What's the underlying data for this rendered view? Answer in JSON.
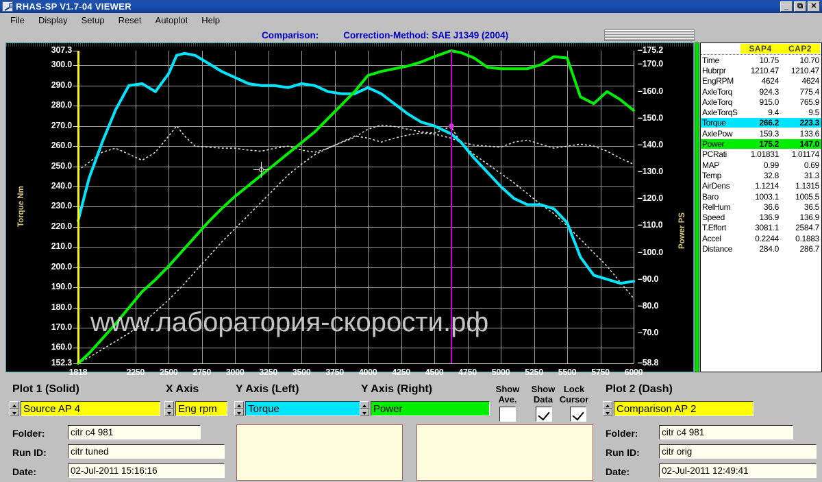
{
  "window": {
    "title": "RHAS-SP V1.7-04  VIEWER",
    "icon": "app-icon",
    "buttons": {
      "minimize": "_",
      "maximize": "❐",
      "close": "×"
    }
  },
  "menu": {
    "items": [
      "File",
      "Display",
      "Setup",
      "Reset",
      "Autoplot",
      "Help"
    ]
  },
  "header": {
    "comparison_label": "Comparison:",
    "correction_method": "Correction-Method: SAE J1349 (2004)"
  },
  "chart_data": {
    "type": "line",
    "title": "",
    "xlabel": "Eng rpm",
    "ylabel_left": "Torque Nm",
    "ylabel_right": "Power PS",
    "xlim": [
      1818,
      6000
    ],
    "ylim_left": [
      152.3,
      307.3
    ],
    "ylim_right": [
      58.8,
      175.2
    ],
    "grid": true,
    "x_ticks": [
      1818,
      2250,
      2500,
      2750,
      3000,
      3250,
      3500,
      3750,
      4000,
      4250,
      4500,
      4750,
      5000,
      5250,
      5500,
      5750,
      6000
    ],
    "y_ticks_left": [
      307.3,
      300.0,
      290.0,
      280.0,
      270.0,
      260.0,
      250.0,
      240.0,
      230.0,
      220.0,
      210.0,
      200.0,
      190.0,
      180.0,
      170.0,
      160.0,
      152.3
    ],
    "y_ticks_right": [
      175.2,
      170.0,
      160.0,
      150.0,
      140.0,
      130.0,
      120.0,
      110.0,
      100.0,
      90.0,
      80.0,
      70.0,
      58.8
    ],
    "cursor_left_rpm": 1818,
    "cursor_right_rpm": 4624,
    "watermark": "www.лаборатория-скорости.рф",
    "series": [
      {
        "name": "Torque AP4 (solid cyan)",
        "color": "#00E5FF",
        "style": "solid",
        "axis": "left",
        "x": [
          1818,
          1900,
          2000,
          2100,
          2200,
          2300,
          2400,
          2500,
          2560,
          2620,
          2700,
          2800,
          2900,
          3000,
          3100,
          3200,
          3300,
          3400,
          3500,
          3600,
          3700,
          3800,
          3900,
          4000,
          4100,
          4200,
          4300,
          4400,
          4500,
          4624,
          4700,
          4800,
          4900,
          5000,
          5100,
          5200,
          5300,
          5400,
          5500,
          5600,
          5700,
          5800,
          5900,
          6000
        ],
        "y": [
          223.0,
          244.0,
          262.0,
          278.0,
          290.0,
          291.0,
          287.0,
          296.0,
          305.0,
          306.0,
          305.0,
          301.0,
          297.0,
          294.0,
          291.0,
          290.0,
          290.0,
          289.0,
          291.0,
          290.0,
          287.0,
          286.0,
          286.0,
          289.0,
          286.0,
          281.0,
          276.0,
          272.0,
          270.0,
          266.2,
          262.0,
          254.0,
          247.0,
          240.0,
          234.0,
          231.0,
          231.0,
          229.0,
          222.0,
          205.0,
          196.0,
          194.0,
          192.0,
          193.0
        ]
      },
      {
        "name": "Power AP4 (solid green)",
        "color": "#00EE00",
        "style": "solid",
        "axis": "right",
        "x": [
          1818,
          1900,
          2000,
          2100,
          2200,
          2300,
          2400,
          2500,
          2600,
          2700,
          2800,
          2900,
          3000,
          3100,
          3200,
          3300,
          3400,
          3500,
          3600,
          3700,
          3800,
          3900,
          4000,
          4100,
          4200,
          4300,
          4400,
          4500,
          4624,
          4700,
          4800,
          4900,
          5000,
          5100,
          5200,
          5300,
          5400,
          5500,
          5600,
          5700,
          5800,
          5900,
          6000
        ],
        "y": [
          58.8,
          62.5,
          68.0,
          73.5,
          79.5,
          85.5,
          90.0,
          95.0,
          100.5,
          106.0,
          111.5,
          116.5,
          121.0,
          125.0,
          129.0,
          133.0,
          137.0,
          141.0,
          145.0,
          150.0,
          155.0,
          160.0,
          166.0,
          167.5,
          168.5,
          169.5,
          171.0,
          173.0,
          175.2,
          174.5,
          172.5,
          169.0,
          168.5,
          168.5,
          168.5,
          170.0,
          173.0,
          172.5,
          158.0,
          155.5,
          160.0,
          157.0,
          153.0
        ]
      },
      {
        "name": "Torque AP2 (dashed)",
        "color": "#D8D8D8",
        "style": "dashed",
        "axis": "left",
        "x": [
          1818,
          1900,
          2000,
          2100,
          2200,
          2300,
          2400,
          2500,
          2560,
          2620,
          2700,
          2800,
          2900,
          3000,
          3100,
          3200,
          3300,
          3400,
          3500,
          3600,
          3700,
          3800,
          3900,
          4000,
          4100,
          4200,
          4300,
          4400,
          4500,
          4624,
          4700,
          4800,
          4900,
          5000,
          5100,
          5200,
          5300,
          5400,
          5500,
          5600,
          5700,
          5800,
          5900,
          6000
        ],
        "y": [
          248.0,
          252.0,
          257.0,
          259.0,
          256.0,
          253.0,
          257.0,
          265.0,
          270.0,
          265.0,
          260.0,
          259.5,
          259.0,
          259.0,
          258.0,
          257.5,
          259.0,
          260.0,
          258.0,
          257.0,
          259.0,
          262.0,
          265.0,
          264.0,
          262.0,
          264.0,
          265.5,
          266.5,
          266.0,
          264.0,
          262.0,
          260.5,
          260.0,
          259.5,
          262.0,
          263.0,
          261.0,
          259.0,
          260.0,
          261.0,
          260.0,
          257.5,
          254.0,
          251.0
        ]
      },
      {
        "name": "Power AP2 (dashed)",
        "color": "#D8D8D8",
        "style": "dashed",
        "axis": "right",
        "x": [
          1818,
          1900,
          2000,
          2100,
          2200,
          2300,
          2400,
          2500,
          2600,
          2700,
          2800,
          2900,
          3000,
          3100,
          3200,
          3300,
          3400,
          3500,
          3600,
          3700,
          3800,
          3900,
          4000,
          4100,
          4200,
          4300,
          4400,
          4500,
          4624,
          4700,
          4800,
          4900,
          5000,
          5100,
          5200,
          5300,
          5400,
          5500,
          5600,
          5700,
          5800,
          5900,
          6000
        ],
        "y": [
          58.8,
          61.0,
          64.0,
          67.0,
          70.0,
          73.5,
          78.0,
          82.5,
          87.5,
          93.0,
          98.5,
          104.0,
          109.0,
          114.0,
          119.0,
          124.0,
          129.0,
          133.0,
          136.5,
          139.0,
          141.0,
          143.0,
          146.0,
          147.5,
          147.0,
          146.0,
          145.0,
          144.5,
          147.0,
          141.0,
          136.5,
          133.0,
          129.5,
          126.0,
          122.0,
          118.0,
          114.5,
          110.0,
          105.0,
          100.0,
          95.0,
          89.0,
          83.0
        ]
      }
    ]
  },
  "data_panel": {
    "columns": [
      "",
      "SAP4",
      "CAP2"
    ],
    "rows": [
      {
        "label": "Time",
        "v1": "10.75",
        "v2": "10.70",
        "highlight": "none"
      },
      {
        "label": "Hubrpr",
        "v1": "1210.47",
        "v2": "1210.47",
        "highlight": "none"
      },
      {
        "label": "EngRPM",
        "v1": "4624",
        "v2": "4624",
        "highlight": "none"
      },
      {
        "label": "AxleTorq",
        "v1": "924.3",
        "v2": "775.4",
        "highlight": "none"
      },
      {
        "label": "AxleTorq",
        "v1": "915.0",
        "v2": "765.9",
        "highlight": "none"
      },
      {
        "label": "AxleTorqS",
        "v1": "9.4",
        "v2": "9.5",
        "highlight": "none"
      },
      {
        "label": "Torque",
        "v1": "266.2",
        "v2": "223.3",
        "highlight": "torque"
      },
      {
        "label": "AxlePow",
        "v1": "159.3",
        "v2": "133.6",
        "highlight": "none"
      },
      {
        "label": "Power",
        "v1": "175.2",
        "v2": "147.0",
        "highlight": "power"
      },
      {
        "label": "PCRati",
        "v1": "1.01831",
        "v2": "1.01174",
        "highlight": "none"
      },
      {
        "label": "MAP",
        "v1": "0.99",
        "v2": "0.69",
        "highlight": "none"
      },
      {
        "label": "Temp",
        "v1": "32.8",
        "v2": "31.3",
        "highlight": "none"
      },
      {
        "label": "AirDens",
        "v1": "1.1214",
        "v2": "1.1315",
        "highlight": "none"
      },
      {
        "label": "Baro",
        "v1": "1003.1",
        "v2": "1005.5",
        "highlight": "none"
      },
      {
        "label": "RelHum",
        "v1": "36.6",
        "v2": "36.5",
        "highlight": "none"
      },
      {
        "label": "Speed",
        "v1": "136.9",
        "v2": "136.9",
        "highlight": "none"
      },
      {
        "label": "T.Effort",
        "v1": "3081.1",
        "v2": "2584.7",
        "highlight": "none"
      },
      {
        "label": "Accel",
        "v1": "0.2244",
        "v2": "0.1883",
        "highlight": "none"
      },
      {
        "label": "Distance",
        "v1": "284.0",
        "v2": "286.7",
        "highlight": "none"
      }
    ]
  },
  "controls": {
    "plot1": {
      "title": "Plot 1 (Solid)",
      "source_value": "Source AP 4",
      "folder_label": "Folder:",
      "folder_value": "citr c4 981",
      "runid_label": "Run ID:",
      "runid_value": "citr tuned",
      "date_label": "Date:",
      "date_value": "02-Jul-2011  15:16:16"
    },
    "x_axis": {
      "title": "X Axis",
      "value": "Eng rpm"
    },
    "y_axis_left": {
      "title": "Y Axis (Left)",
      "value": "Torque"
    },
    "y_axis_right": {
      "title": "Y Axis (Right)",
      "value": "Power"
    },
    "show_ave": {
      "line1": "Show",
      "line2": "Ave.",
      "checked": false
    },
    "show_data": {
      "line1": "Show",
      "line2": "Data",
      "checked": true
    },
    "lock_cursor": {
      "line1": "Lock",
      "line2": "Cursor",
      "checked": true
    },
    "plot2": {
      "title": "Plot 2 (Dash)",
      "source_value": "Comparison AP 2",
      "folder_label": "Folder:",
      "folder_value": "citr c4 981",
      "runid_label": "Run ID:",
      "runid_value": "citr orig",
      "date_label": "Date:",
      "date_value": "02-Jul-2011  12:49:41"
    },
    "note1_value": "",
    "note2_value": ""
  },
  "colors": {
    "torque": "#00E5FF",
    "power": "#00EE00",
    "select_yellow": "#FFFF00",
    "cursor_yellow": "#FFFF00",
    "cursor_magenta": "#CC00CC",
    "title_blue": "#0000C8"
  }
}
